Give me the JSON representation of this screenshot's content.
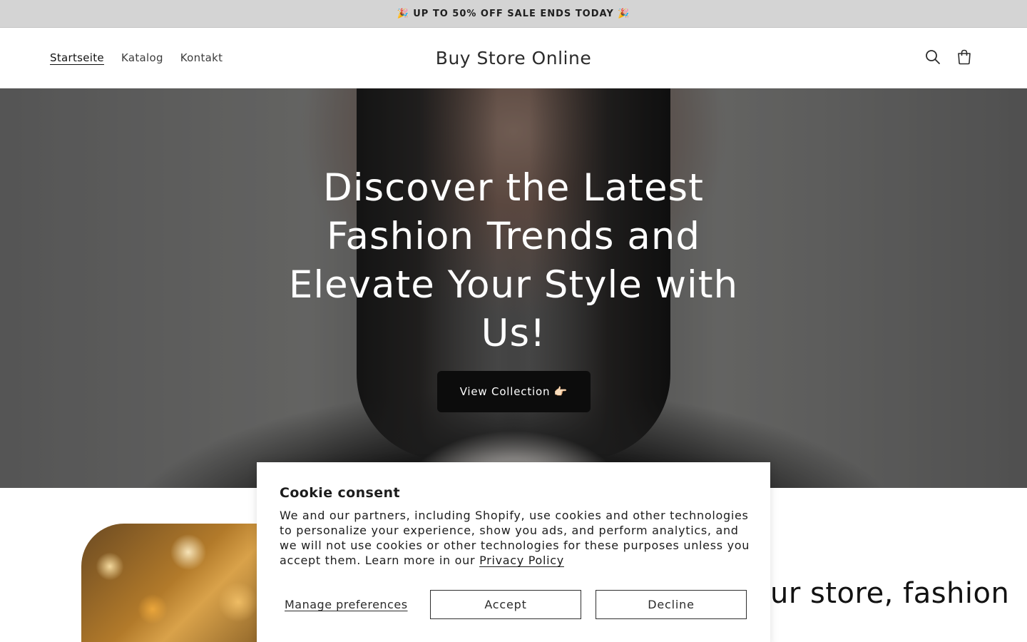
{
  "announcement": {
    "text": "🎉 UP TO 50% OFF SALE ENDS TODAY 🎉"
  },
  "header": {
    "nav": [
      {
        "label": "Startseite",
        "active": true
      },
      {
        "label": "Katalog",
        "active": false
      },
      {
        "label": "Kontakt",
        "active": false
      }
    ],
    "brand": "Buy Store Online",
    "icons": [
      "search-icon",
      "cart-icon"
    ]
  },
  "hero": {
    "title": "Discover the Latest Fashion Trends and Elevate Your Style with Us!",
    "button_label": "View Collection 👉🏻"
  },
  "section": {
    "heading": "ur store, fashion"
  },
  "cookie": {
    "title": "Cookie consent",
    "body": "We and our partners, including Shopify, use cookies and other technologies to personalize your experience, show you ads, and perform analytics, and we will not use cookies or other technologies for these purposes unless you accept them. Learn more in our",
    "link": "Privacy Policy",
    "manage_label": "Manage preferences",
    "accept_label": "Accept",
    "decline_label": "Decline"
  },
  "colors": {
    "announcement_bg": "#d4d4d4",
    "button_dark": "#0c0c0c",
    "text": "#121212"
  }
}
